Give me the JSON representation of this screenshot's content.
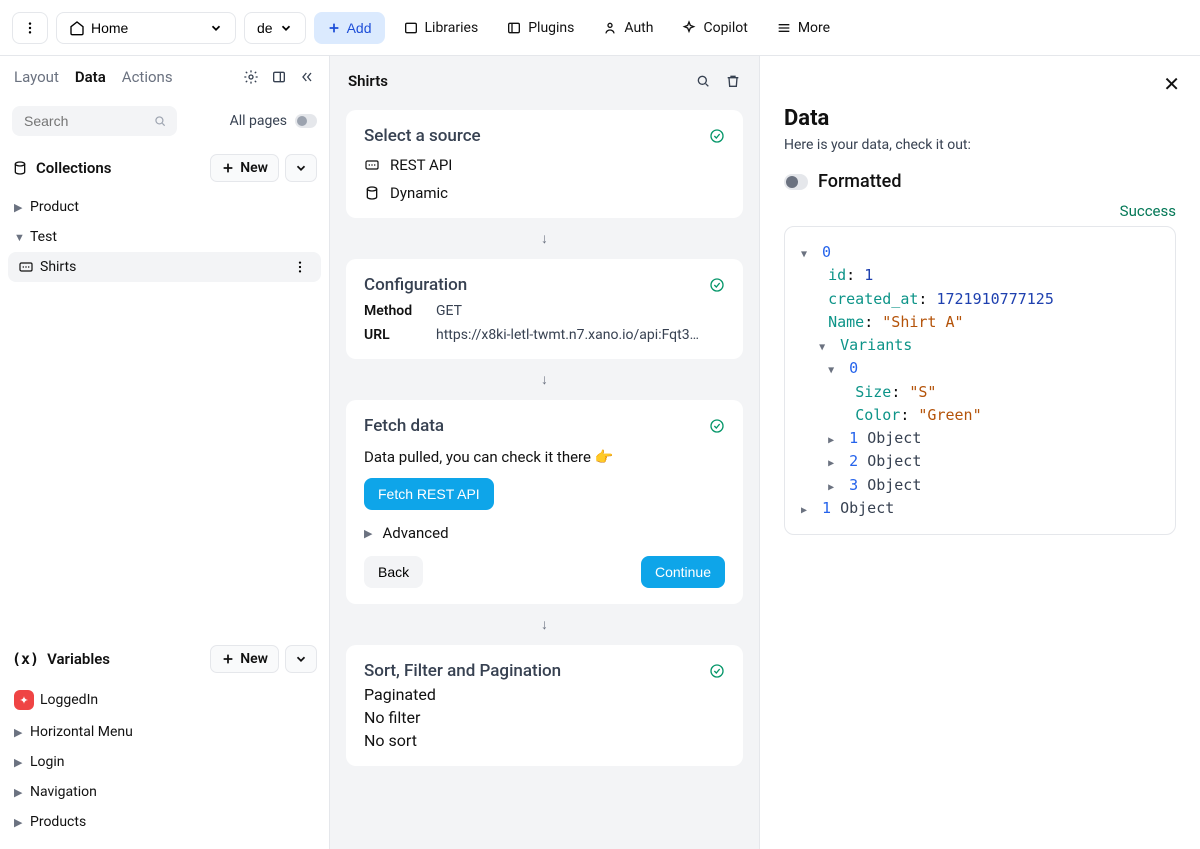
{
  "topbar": {
    "home": "Home",
    "lang": "de",
    "add": "Add",
    "nav": [
      "Libraries",
      "Plugins",
      "Auth",
      "Copilot",
      "More"
    ]
  },
  "sidebar": {
    "tabs": [
      "Layout",
      "Data",
      "Actions"
    ],
    "active_tab": 1,
    "search_placeholder": "Search",
    "all_pages": "All pages",
    "collections_label": "Collections",
    "new_label": "New",
    "collections": [
      {
        "label": "Product",
        "expanded": false
      },
      {
        "label": "Test",
        "expanded": true,
        "children": [
          {
            "label": "Shirts",
            "selected": true
          }
        ]
      }
    ],
    "variables_label": "Variables",
    "variables": [
      {
        "label": "LoggedIn",
        "icon": true
      },
      {
        "label": "Horizontal Menu"
      },
      {
        "label": "Login"
      },
      {
        "label": "Navigation"
      },
      {
        "label": "Products"
      }
    ]
  },
  "middle": {
    "title": "Shirts",
    "cards": {
      "source": {
        "title": "Select a source",
        "api": "REST API",
        "dynamic": "Dynamic"
      },
      "config": {
        "title": "Configuration",
        "method_label": "Method",
        "method": "GET",
        "url_label": "URL",
        "url": "https://x8ki-letl-twmt.n7.xano.io/api:Fqt3G..."
      },
      "fetch": {
        "title": "Fetch data",
        "msg": "Data pulled, you can check it there 👉",
        "button": "Fetch REST API",
        "advanced": "Advanced",
        "back": "Back",
        "continue": "Continue"
      },
      "sort": {
        "title": "Sort, Filter and Pagination",
        "lines": [
          "Paginated",
          "No filter",
          "No sort"
        ]
      }
    }
  },
  "right": {
    "title": "Data",
    "subtitle": "Here is your data, check it out:",
    "formatted": "Formatted",
    "status": "Success",
    "json": {
      "idx0": "0",
      "id_key": "id",
      "id_val": "1",
      "created_key": "created_at",
      "created_val": "1721910777125",
      "name_key": "Name",
      "name_val": "\"Shirt A\"",
      "variants_key": "Variants",
      "v0": "0",
      "size_key": "Size",
      "size_val": "\"S\"",
      "color_key": "Color",
      "color_val": "\"Green\"",
      "obj1": "1",
      "obj2": "2",
      "obj3": "3",
      "object_word": "Object",
      "idx1": "1"
    }
  }
}
